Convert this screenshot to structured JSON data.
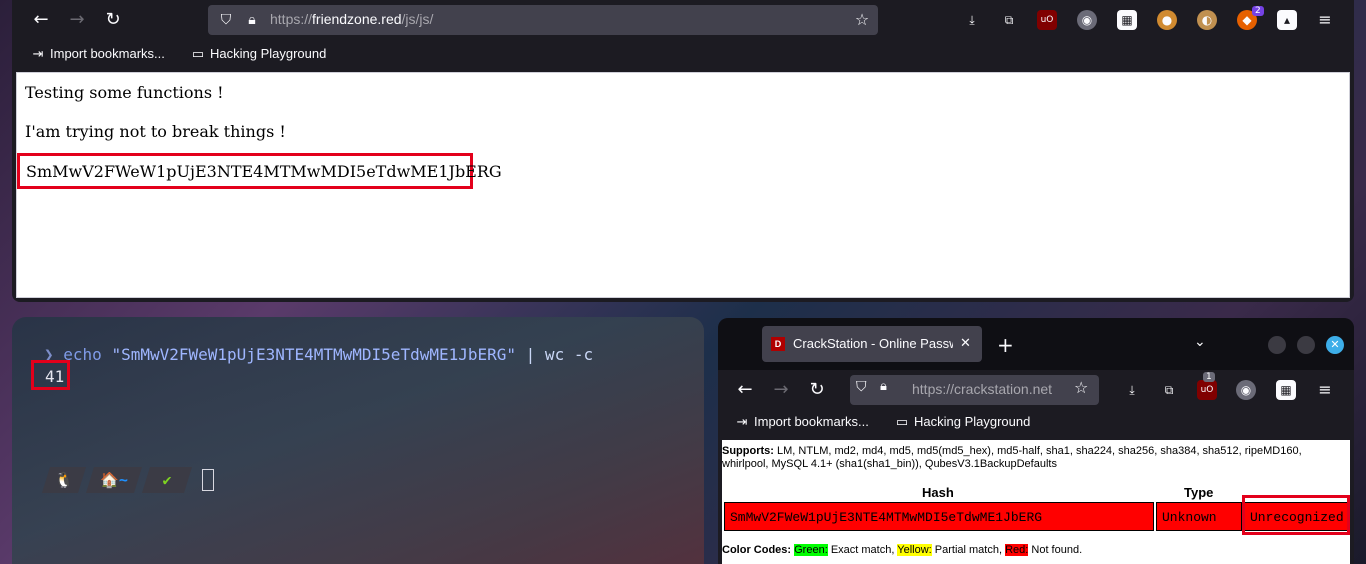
{
  "top_browser": {
    "url_scheme": "https://",
    "url_host": "friendzone.red",
    "url_path": "/js/js/",
    "bookmarks": [
      "Import bookmarks...",
      "Hacking Playground"
    ],
    "extension_badge": "2",
    "content": {
      "line1": "Testing some functions !",
      "line2": "I'am trying not to break things !",
      "encoded": "SmMwV2FWeW1pUjE3NTE4MTMwMDI5eTdwME1JbERG"
    }
  },
  "terminal": {
    "prompt_arrow": "❯",
    "cmd_echo": "echo",
    "cmd_string": "\"SmMwV2FWeW1pUjE3NTE4MTMwMDI5eTdwME1JbERG\"",
    "cmd_rest": " | wc -c",
    "output": "41",
    "prompt_segments": [
      "🐧",
      "🏠~",
      "✔"
    ]
  },
  "crack_browser": {
    "tab_title": "CrackStation - Online Password Hash Cracking",
    "favicon_letter": "D",
    "url": "https://crackstation.net",
    "extension_badge": "1",
    "bookmarks": [
      "Import bookmarks...",
      "Hacking Playground"
    ],
    "supports_label": "Supports:",
    "supports_text": "LM, NTLM, md2, md4, md5, md5(md5_hex), md5-half, sha1, sha224, sha256, sha384, sha512, ripeMD160, whirlpool, MySQL 4.1+ (sha1(sha1_bin)), QubesV3.1BackupDefaults",
    "table_headers": {
      "hash": "Hash",
      "type": "Type"
    },
    "row": {
      "hash": "SmMwV2FWeW1pUjE3NTE4MTMwMDI5eTdwME1JbERG",
      "type": "Unknown",
      "result": "Unrecognized hash format."
    },
    "color_codes": {
      "label": "Color Codes:",
      "green": "Green:",
      "green_desc": " Exact match, ",
      "yellow": "Yellow:",
      "yellow_desc": " Partial match, ",
      "red": "Red:",
      "red_desc": " Not found."
    }
  },
  "colors": {
    "browser_chrome": "#1c1b22",
    "urlbar": "#42414d",
    "highlight_box": "#e3001b",
    "not_found_red": "#ff0000"
  }
}
